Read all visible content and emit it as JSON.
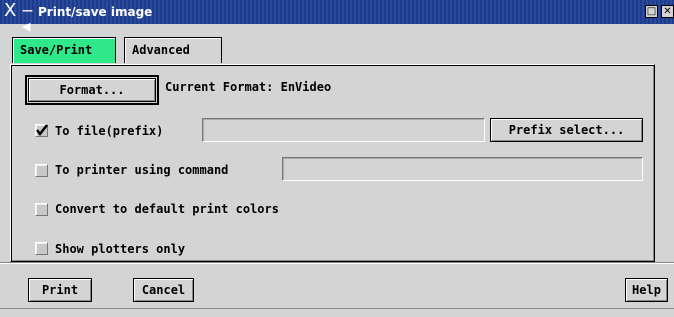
{
  "window": {
    "title": "Print/save image",
    "logo_char": "X",
    "pin_char": "—◀",
    "btn_max": "□",
    "btn_close": "✕"
  },
  "tabs": [
    {
      "label": "Save/Print",
      "active": true
    },
    {
      "label": "Advanced",
      "active": false
    }
  ],
  "format": {
    "button_label": "Format...",
    "current_label": "Current Format: EnVideo"
  },
  "options": {
    "to_file": {
      "label": "To file(prefix)",
      "checked": true,
      "value": ""
    },
    "prefix_select_label": "Prefix select...",
    "to_printer": {
      "label": "To printer using command",
      "checked": false,
      "value": ""
    },
    "convert_colors": {
      "label": "Convert to default print colors",
      "checked": false
    },
    "plotters_only": {
      "label": "Show plotters only",
      "checked": false
    }
  },
  "footer": {
    "print_label": "Print",
    "cancel_label": "Cancel",
    "help_label": "Help"
  },
  "colors": {
    "titlebar": "#1f3c8c",
    "active_tab": "#2ee88a",
    "background": "#d4d4d4"
  }
}
